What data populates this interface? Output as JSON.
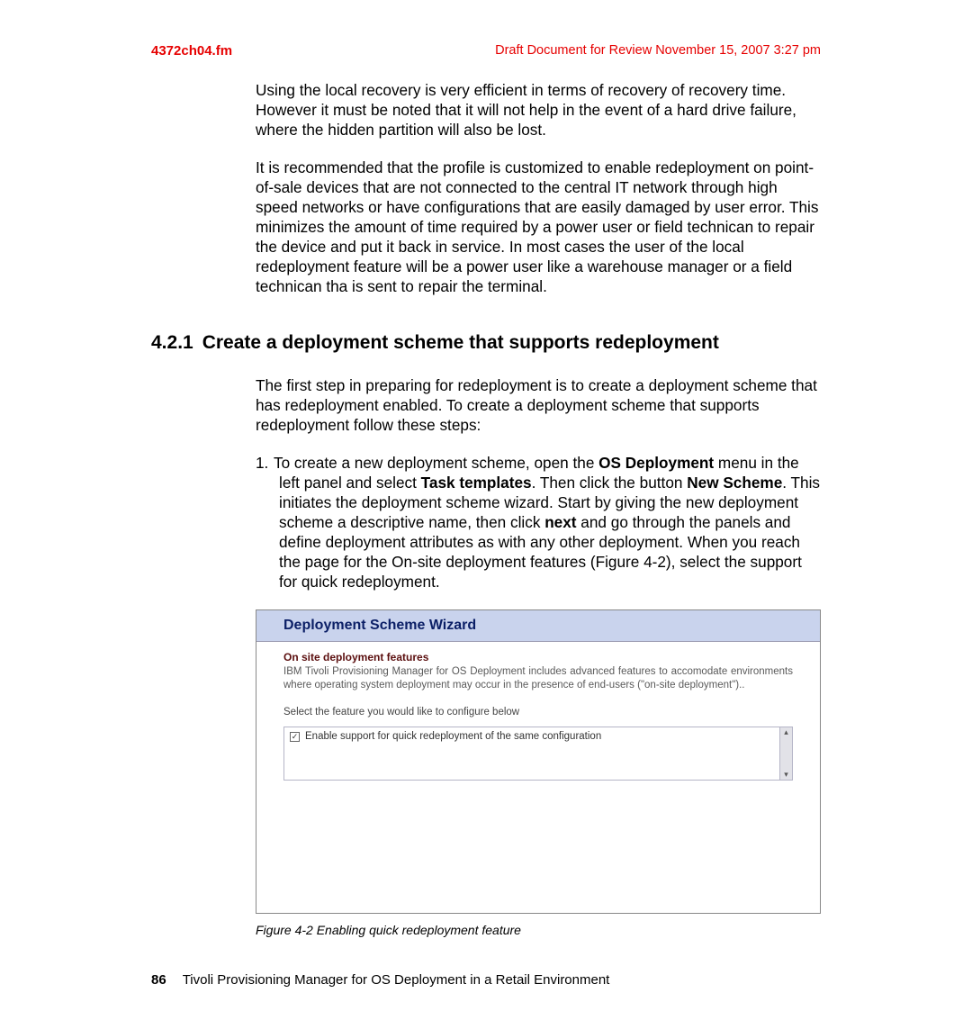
{
  "header": {
    "filename": "4372ch04.fm",
    "draft": "Draft Document for Review November 15, 2007 3:27 pm"
  },
  "para1": "Using the local recovery is very efficient in terms of recovery of recovery time. However it must be noted that it will not help in the event of a hard drive failure, where the hidden partition will also be lost.",
  "para2": "It is recommended that the profile is customized to enable redeployment on point-of-sale devices that are not connected to the central IT network through high speed networks or have configurations that are easily damaged by user error. This minimizes the amount of time required by a power user or field technican to repair the device and put it back in service. In most cases the user of the local redeployment feature will be a power user like a warehouse manager or a field technican tha is sent to repair the terminal.",
  "section": {
    "number": "4.2.1",
    "title": "Create a deployment scheme that supports redeployment"
  },
  "para3": "The first step in preparing for redeployment is to create a deployment scheme that has redeployment enabled. To create a deployment scheme that supports redeployment follow these steps:",
  "step1": {
    "num": "1.",
    "pre1": "To create a new deployment scheme, open the ",
    "b1": "OS Deployment",
    "pre2": " menu in the left panel and select ",
    "b2": "Task templates",
    "pre3": ". Then click the button ",
    "b3": "New Scheme",
    "pre4": ". This initiates the deployment scheme wizard. Start by giving the new deployment scheme a descriptive name, then click ",
    "b4": "next",
    "pre5": " and go through the panels and define deployment attributes as with any other deployment. When you reach the page for the On-site deployment features (Figure 4-2), select the support for quick redeployment."
  },
  "wizard": {
    "title": "Deployment Scheme Wizard",
    "subhead": "On site deployment features",
    "desc": "IBM Tivoli Provisioning Manager for OS Deployment includes advanced features to accomodate environments where operating system deployment may occur in the presence of end-users (\"on-site deployment\")..",
    "select_label": "Select the feature you would like to configure below",
    "option": "Enable support for quick redeployment of the same configuration",
    "check": "☑"
  },
  "figure_caption": "Figure 4-2   Enabling quick redeployment feature",
  "footer": {
    "page": "86",
    "title": "Tivoli Provisioning Manager for OS Deployment in a Retail Environment"
  }
}
